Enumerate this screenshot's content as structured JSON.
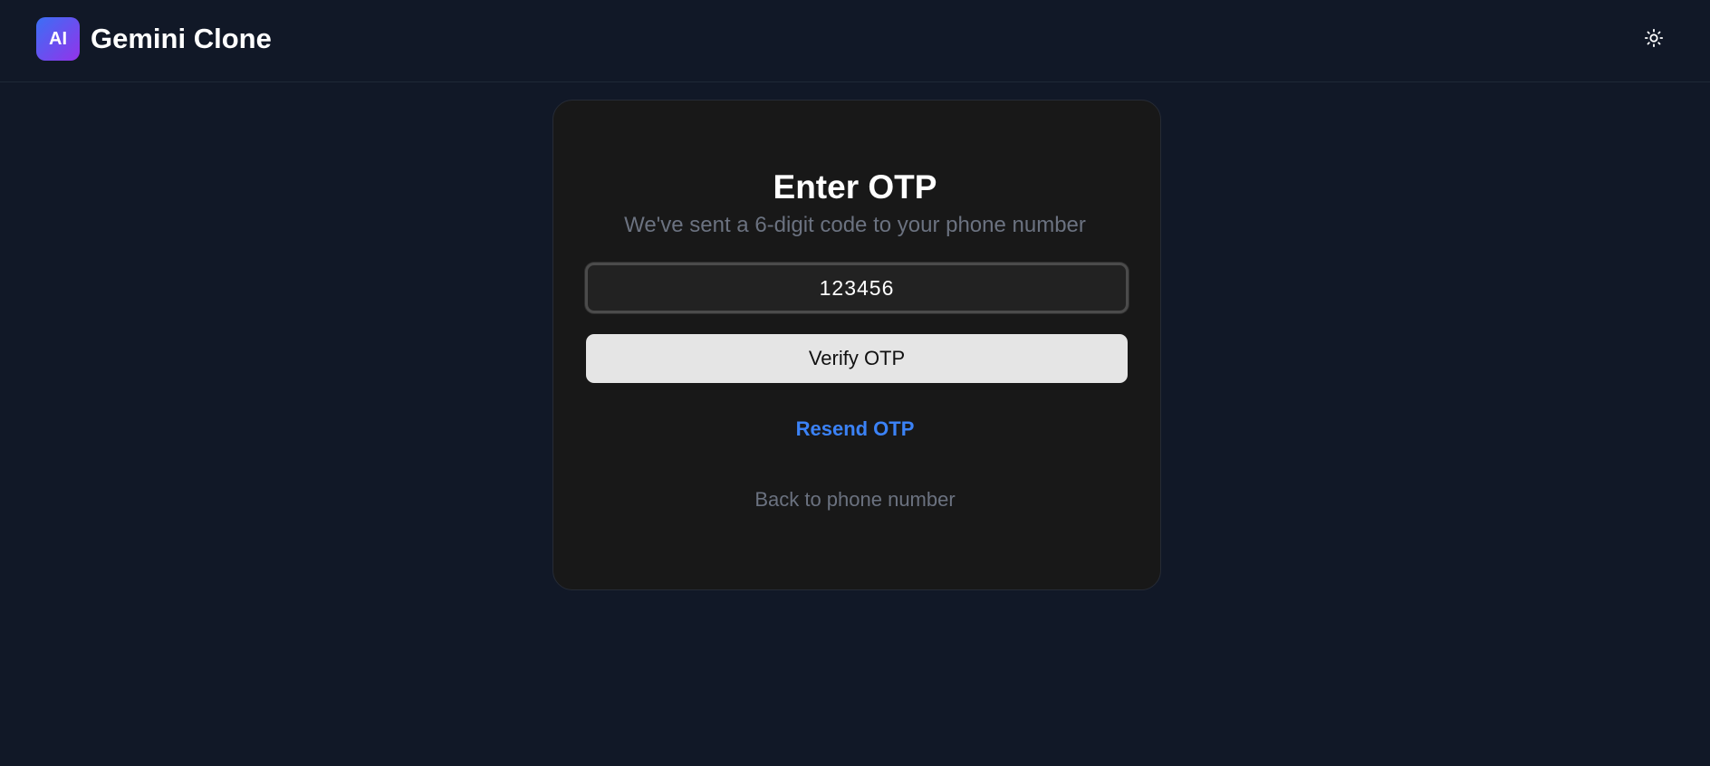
{
  "header": {
    "logo_text": "AI",
    "app_title": "Gemini Clone",
    "theme_icon": "sun-icon"
  },
  "otp_card": {
    "title": "Enter OTP",
    "subtitle": "We've sent a 6-digit code to your phone number",
    "input_value": "123456",
    "verify_label": "Verify OTP",
    "resend_label": "Resend OTP",
    "back_label": "Back to phone number"
  },
  "colors": {
    "background": "#111827",
    "card": "#181818",
    "logo_gradient_start": "#3b6ff5",
    "logo_gradient_end": "#9333ea",
    "link_accent": "#3b82f6",
    "muted_text": "#6b7280"
  }
}
